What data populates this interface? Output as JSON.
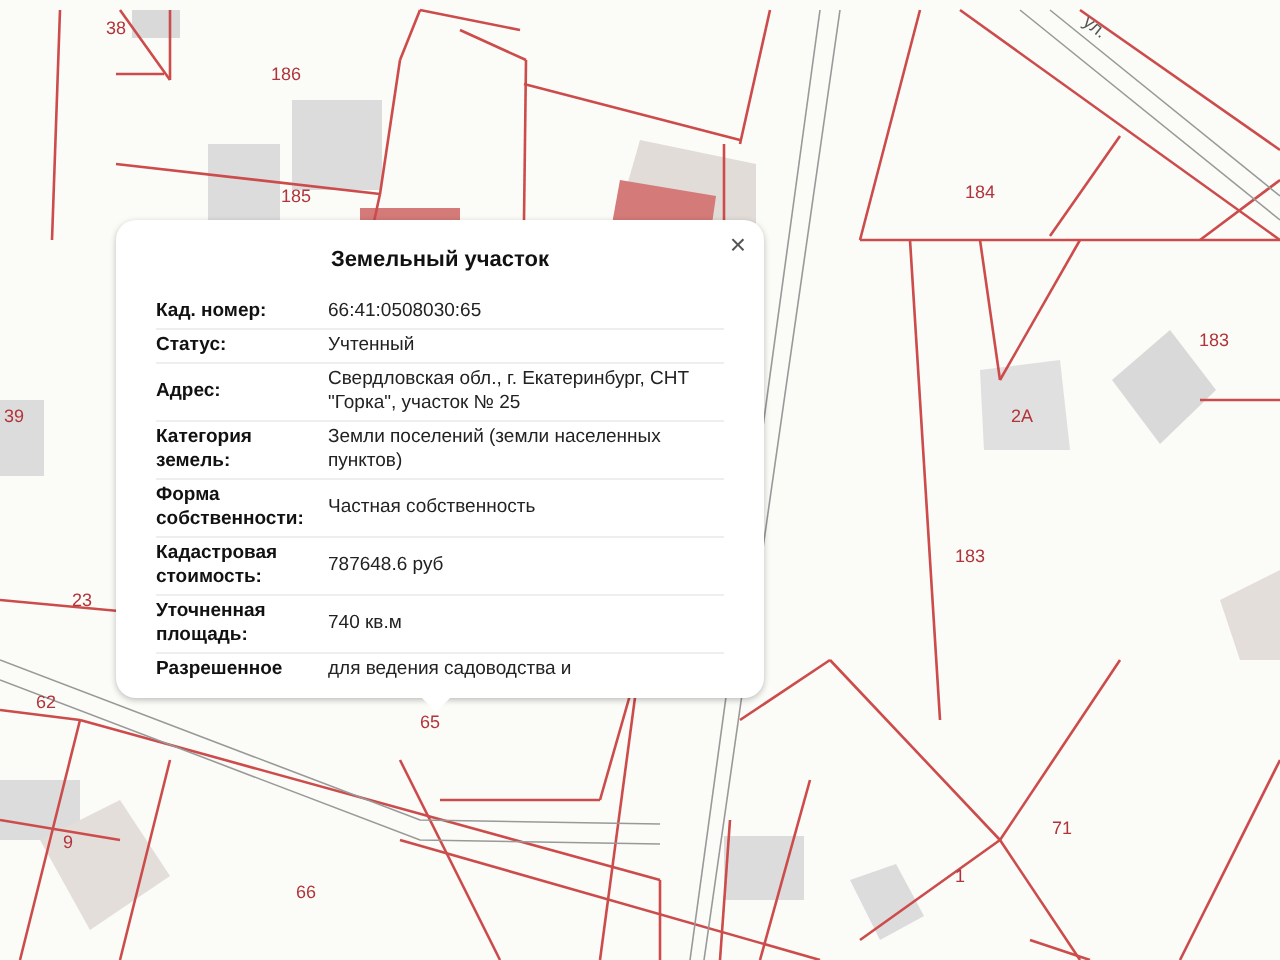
{
  "map": {
    "street_label": "ул.",
    "parcel_numbers": [
      "38",
      "186",
      "185",
      "184",
      "183",
      "2А",
      "183",
      "39",
      "23",
      "62",
      "65",
      "9",
      "66",
      "71",
      "1"
    ]
  },
  "popup": {
    "title": "Земельный участок",
    "close": "×",
    "rows": [
      {
        "label": "Кад. номер:",
        "value": "66:41:0508030:65"
      },
      {
        "label": "Статус:",
        "value": "Учтенный"
      },
      {
        "label": "Адрес:",
        "value": "Свердловская обл., г. Екатеринбург, СНТ \"Горка\", участок № 25"
      },
      {
        "label": "Категория земель:",
        "value": "Земли поселений (земли населенных пунктов)"
      },
      {
        "label": "Форма собственности:",
        "value": "Частная собственность"
      },
      {
        "label": "Кадастровая стоимость:",
        "value": "787648.6 руб"
      },
      {
        "label": "Уточненная площадь:",
        "value": "740 кв.м"
      },
      {
        "label": "Разрешенное",
        "value": "для ведения садоводства и"
      }
    ]
  }
}
